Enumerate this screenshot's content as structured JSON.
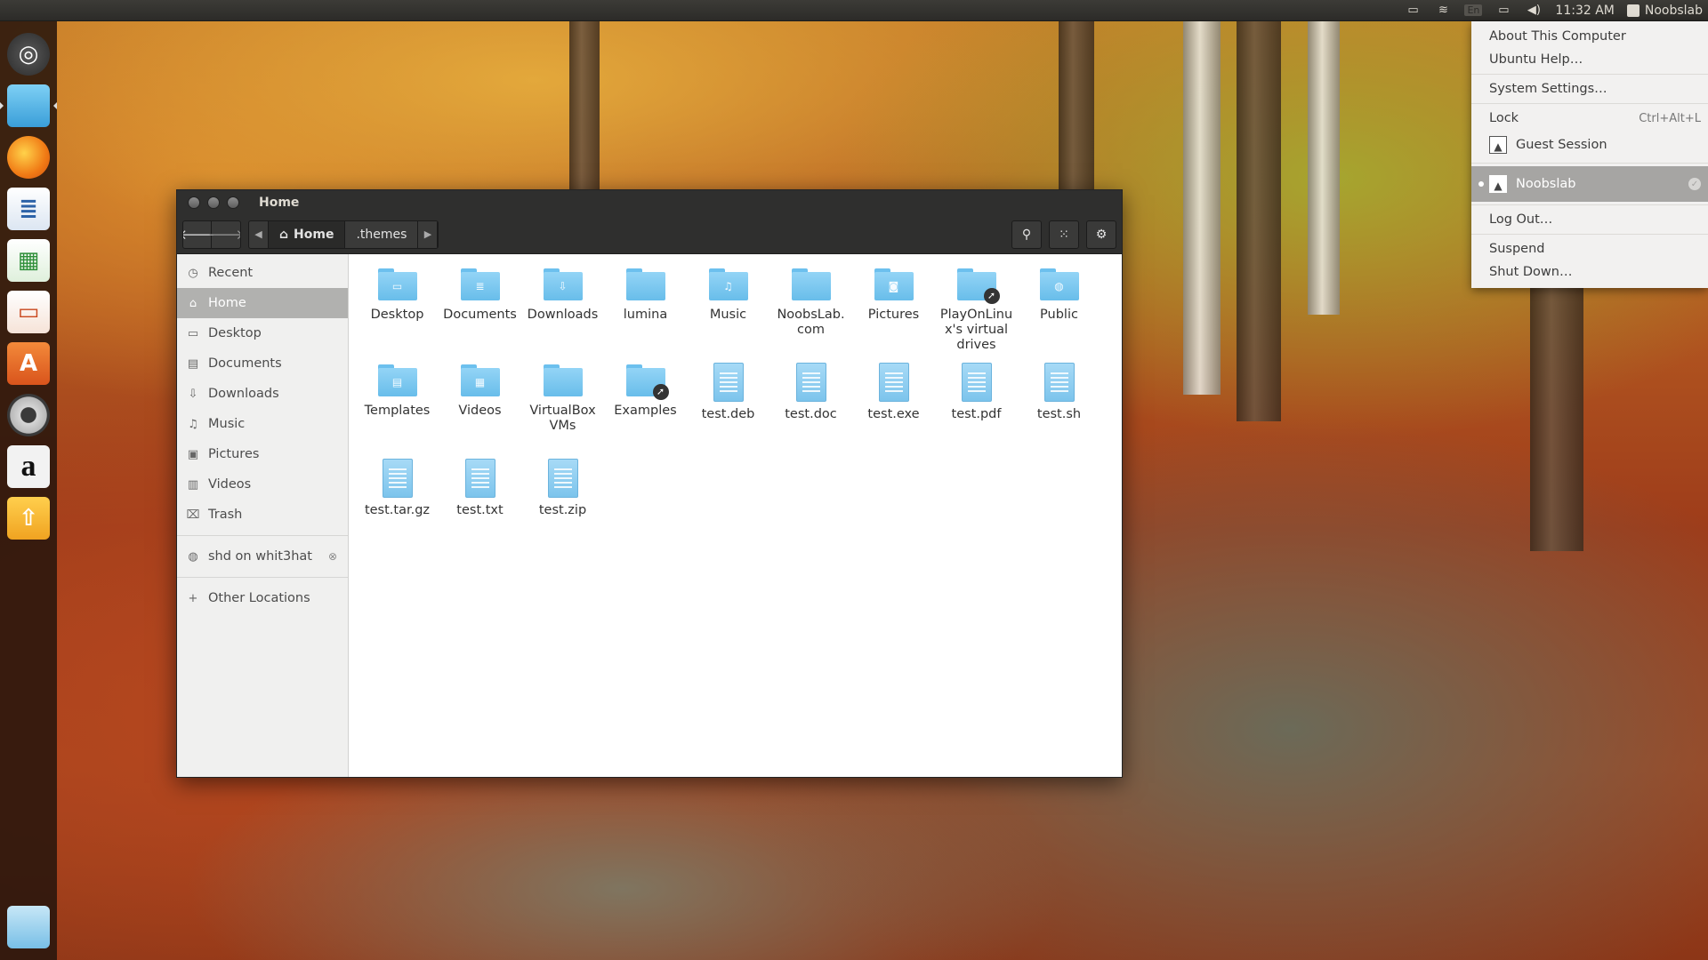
{
  "top_panel": {
    "keyboard_indicator": "En",
    "clock": "11:32 AM",
    "username": "Noobslab"
  },
  "launcher": {
    "items": [
      {
        "name": "dash-icon",
        "glyph": "◎"
      },
      {
        "name": "files-icon",
        "glyph": ""
      },
      {
        "name": "firefox-icon",
        "glyph": ""
      },
      {
        "name": "libreoffice-writer-icon",
        "glyph": "≣"
      },
      {
        "name": "libreoffice-calc-icon",
        "glyph": "▦"
      },
      {
        "name": "libreoffice-impress-icon",
        "glyph": "▭"
      },
      {
        "name": "software-center-icon",
        "glyph": "A"
      },
      {
        "name": "system-settings-icon",
        "glyph": ""
      },
      {
        "name": "amazon-icon",
        "glyph": "a"
      },
      {
        "name": "software-updater-icon",
        "glyph": "⇧"
      }
    ]
  },
  "window": {
    "title": "Home",
    "path": {
      "current": "Home",
      "next": ".themes"
    },
    "sidebar": {
      "items": [
        {
          "label": "Recent",
          "icon": "clock-icon",
          "glyph": "◷"
        },
        {
          "label": "Home",
          "icon": "home-icon",
          "glyph": "⌂"
        },
        {
          "label": "Desktop",
          "icon": "desktop-icon",
          "glyph": "▭"
        },
        {
          "label": "Documents",
          "icon": "documents-icon",
          "glyph": "▤"
        },
        {
          "label": "Downloads",
          "icon": "downloads-icon",
          "glyph": "⇩"
        },
        {
          "label": "Music",
          "icon": "music-icon",
          "glyph": "♫"
        },
        {
          "label": "Pictures",
          "icon": "pictures-icon",
          "glyph": "▣"
        },
        {
          "label": "Videos",
          "icon": "videos-icon",
          "glyph": "▥"
        },
        {
          "label": "Trash",
          "icon": "trash-icon",
          "glyph": "⌧"
        }
      ],
      "network": {
        "label": "shd on whit3hat",
        "glyph": "◍"
      },
      "other": {
        "label": "Other Locations",
        "glyph": "+"
      }
    },
    "files": [
      {
        "name": "Desktop",
        "kind": "folder",
        "emblem": "▭"
      },
      {
        "name": "Documents",
        "kind": "folder",
        "emblem": "≣"
      },
      {
        "name": "Downloads",
        "kind": "folder",
        "emblem": "⇩"
      },
      {
        "name": "lumina",
        "kind": "folder",
        "emblem": ""
      },
      {
        "name": "Music",
        "kind": "folder",
        "emblem": "♫"
      },
      {
        "name": "NoobsLab.\ncom",
        "kind": "folder",
        "emblem": ""
      },
      {
        "name": "Pictures",
        "kind": "folder",
        "emblem": "◙"
      },
      {
        "name": "PlayOnLinu\nx's virtual\ndrives",
        "kind": "folder-link",
        "emblem": ""
      },
      {
        "name": "Public",
        "kind": "folder",
        "emblem": "◍"
      },
      {
        "name": "Templates",
        "kind": "folder",
        "emblem": "▤"
      },
      {
        "name": "Videos",
        "kind": "folder",
        "emblem": "▦"
      },
      {
        "name": "VirtualBox\nVMs",
        "kind": "folder",
        "emblem": ""
      },
      {
        "name": "Examples",
        "kind": "folder-link",
        "emblem": ""
      },
      {
        "name": "test.deb",
        "kind": "file"
      },
      {
        "name": "test.doc",
        "kind": "file"
      },
      {
        "name": "test.exe",
        "kind": "file"
      },
      {
        "name": "test.pdf",
        "kind": "file"
      },
      {
        "name": "test.sh",
        "kind": "file"
      },
      {
        "name": "test.tar.gz",
        "kind": "file"
      },
      {
        "name": "test.txt",
        "kind": "file"
      },
      {
        "name": "test.zip",
        "kind": "file"
      }
    ]
  },
  "session_menu": {
    "about": "About This Computer",
    "help": "Ubuntu Help…",
    "settings": "System Settings…",
    "lock": "Lock",
    "lock_shortcut": "Ctrl+Alt+L",
    "guest": "Guest Session",
    "current_user": "Noobslab",
    "logout": "Log Out…",
    "suspend": "Suspend",
    "shutdown": "Shut Down…"
  }
}
